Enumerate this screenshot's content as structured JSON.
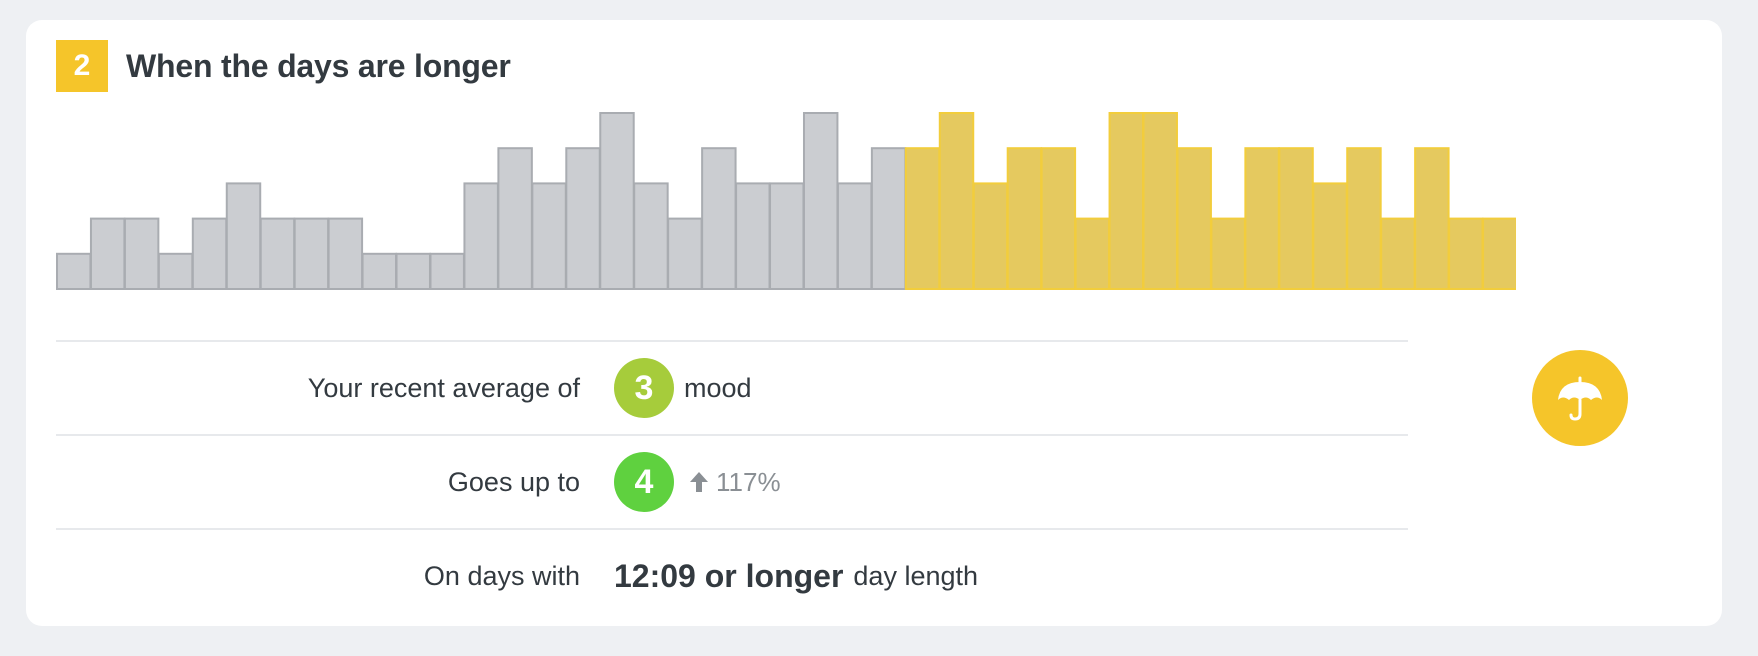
{
  "card": {
    "rank": "2",
    "title": "When the days are longer",
    "icon": "umbrella-icon",
    "accent_color": "#f5c52a"
  },
  "chart_data": {
    "type": "bar",
    "values": [
      1,
      2,
      2,
      1,
      2,
      3,
      2,
      2,
      2,
      1,
      1,
      1,
      3,
      4,
      3,
      4,
      5,
      3,
      2,
      4,
      3,
      3,
      5,
      3,
      4,
      4,
      5,
      3,
      4,
      4,
      2,
      5,
      5,
      4,
      2,
      4,
      4,
      3,
      4,
      2,
      4,
      2,
      2
    ],
    "highlight_start_index": 25,
    "colors": {
      "base": "#cbcdd1",
      "highlight": "#e5c95f"
    },
    "ylim": [
      0,
      5
    ],
    "title": "",
    "xlabel": "",
    "ylabel": ""
  },
  "rows": {
    "average": {
      "label": "Your recent average of",
      "badge": "3",
      "badge_color": "#a6cc3b",
      "unit": "mood"
    },
    "goes_up": {
      "label": "Goes up to",
      "badge": "4",
      "badge_color": "#5fd13f",
      "change": "117%",
      "change_icon": "arrow-up-icon"
    },
    "condition": {
      "label": "On days with",
      "value": "12:09 or longer",
      "suffix": "day length"
    }
  }
}
